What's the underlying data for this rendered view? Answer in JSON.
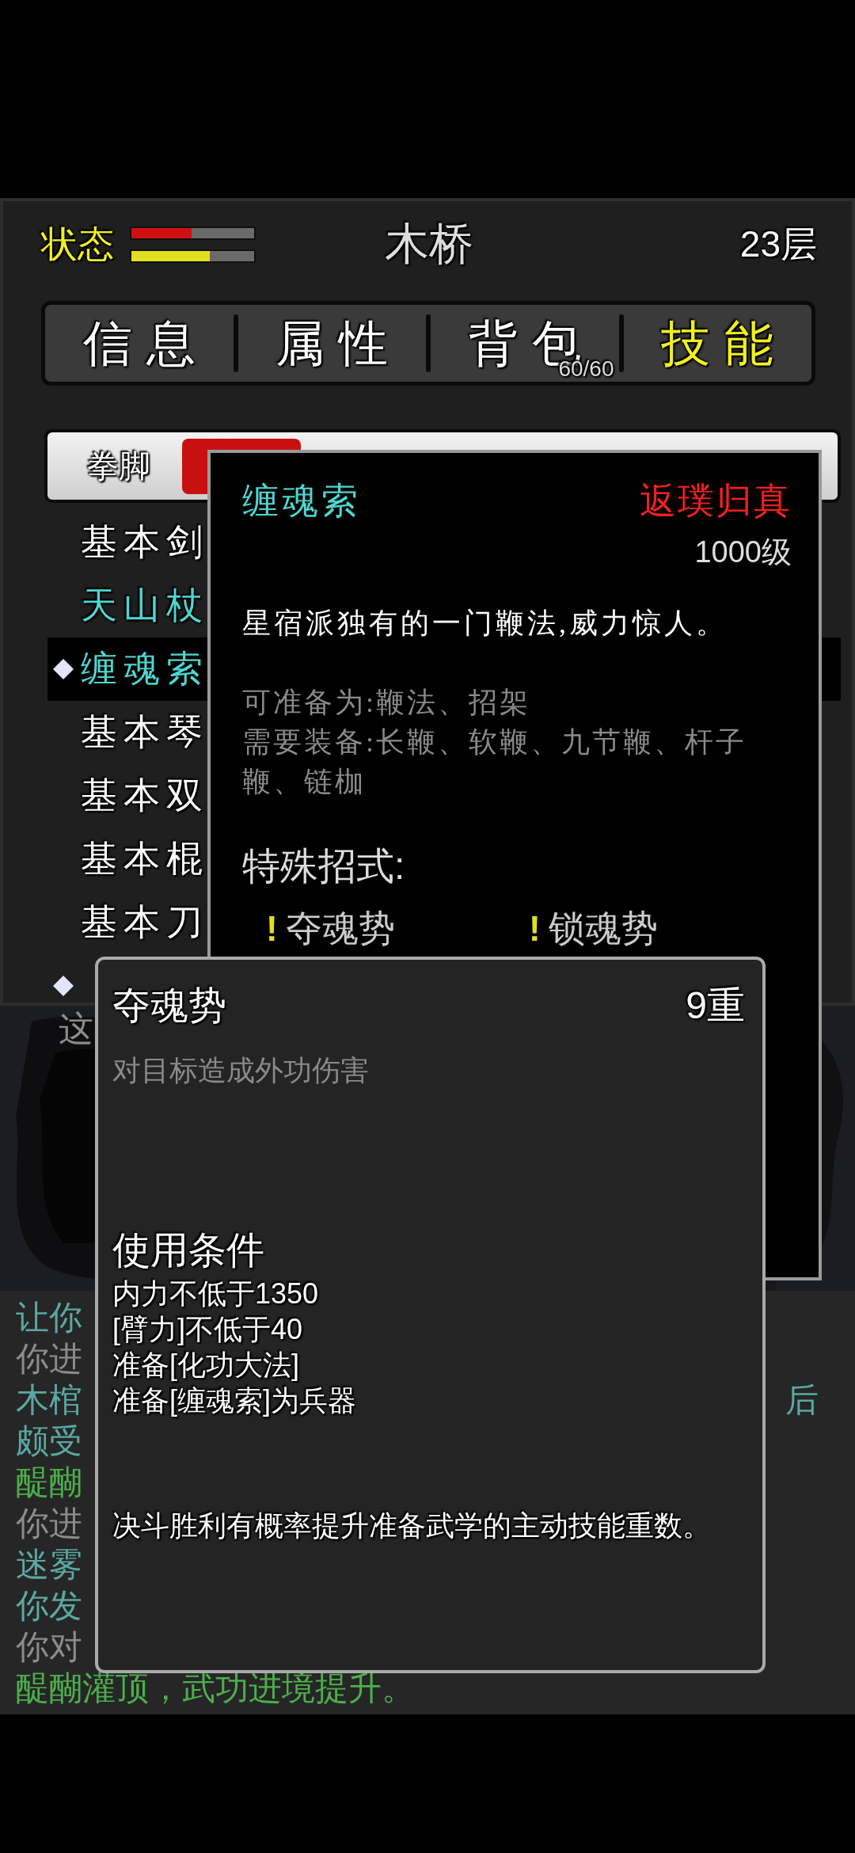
{
  "header": {
    "status_label": "状态",
    "bars": [
      {
        "kind": "health",
        "level": 0.49
      },
      {
        "kind": "energy",
        "level": 0.64
      }
    ],
    "location": "木桥",
    "floor": "23层"
  },
  "tabs": [
    {
      "label": "信息",
      "selected": false
    },
    {
      "label": "属性",
      "selected": false
    },
    {
      "label": "背包",
      "selected": false,
      "badge": "60/60"
    },
    {
      "label": "技能",
      "selected": true
    }
  ],
  "categories": [
    {
      "label": "拳脚",
      "selected": false
    },
    {
      "selected": true
    }
  ],
  "skills": [
    {
      "name": "基本剑",
      "color": "#ffffff",
      "marked": false,
      "selected": false
    },
    {
      "name": "天山杖",
      "color": "#4fd6d0",
      "marked": false,
      "selected": false
    },
    {
      "name": "缠魂索",
      "color": "#4fd6d0",
      "marked": true,
      "selected": true
    },
    {
      "name": "基本琴",
      "color": "#ffffff",
      "marked": false,
      "selected": false
    },
    {
      "name": "基本双",
      "color": "#ffffff",
      "marked": false,
      "selected": false
    },
    {
      "name": "基本棍",
      "color": "#ffffff",
      "marked": false,
      "selected": false
    },
    {
      "name": "基本刀",
      "color": "#ffffff",
      "marked": false,
      "selected": false
    },
    {
      "marked": true,
      "selected": false
    }
  ],
  "scene": {
    "kind": "picture",
    "caption": "这"
  },
  "log": [
    {
      "text": "让你",
      "color": "#5ba8a2"
    },
    {
      "text": "你进",
      "color": "#8c8c8c"
    },
    {
      "text": "木棺",
      "color": "#5ba8a2",
      "tail": "后"
    },
    {
      "text": "颇受",
      "color": "#5ba8a2"
    },
    {
      "text": "醍醐",
      "color": "#4cae4c"
    },
    {
      "text": "你进",
      "color": "#8c8c8c"
    },
    {
      "text": "迷雾",
      "color": "#5ba8a2"
    },
    {
      "text": "你发",
      "color": "#5ba8a2"
    },
    {
      "text": "你对",
      "color": "#8c8c8c"
    },
    {
      "text": "醍醐灌顶，武功进境提升。",
      "color": "#4cae4c"
    }
  ],
  "skill_popup": {
    "name": "缠魂索",
    "rank": "返璞归真",
    "level": "1000级",
    "description": "星宿派独有的一门鞭法,威力惊人。",
    "notes": [
      "可准备为:鞭法、招架",
      "需要装备:长鞭、软鞭、九节鞭、杆子鞭、链枷"
    ],
    "moves_heading": "特殊招式:",
    "moves": [
      {
        "mark": "!",
        "name": "夺魂势"
      },
      {
        "mark": "!",
        "name": "锁魂势"
      }
    ]
  },
  "move_popup": {
    "name": "夺魂势",
    "tier": "9重",
    "effect": "对目标造成外功伤害",
    "conditions_heading": "使用条件",
    "conditions": [
      "内力不低于1350",
      "[臂力]不低于40",
      "准备[化功大法]",
      "准备[缠魂索]为兵器"
    ],
    "note": "决斗胜利有概率提升准备武学的主动技能重数。"
  }
}
